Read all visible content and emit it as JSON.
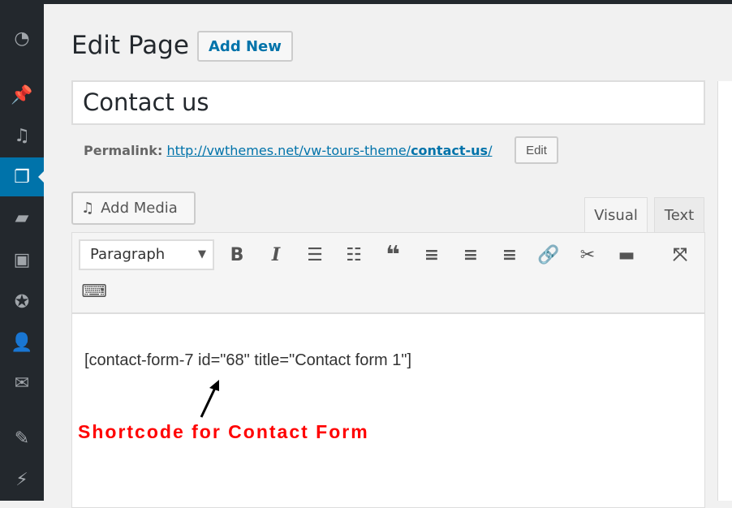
{
  "sidebar": {
    "items": [
      {
        "icon": "dashboard-icon",
        "glyph": "◔"
      },
      {
        "icon": "pin-icon",
        "glyph": "📌"
      },
      {
        "icon": "media-icon",
        "glyph": "♫"
      },
      {
        "icon": "pages-icon",
        "glyph": "❐",
        "active": true
      },
      {
        "icon": "comments-icon",
        "glyph": "▰"
      },
      {
        "icon": "gallery-icon",
        "glyph": "▣"
      },
      {
        "icon": "award-icon",
        "glyph": "✪"
      },
      {
        "icon": "user-icon",
        "glyph": "👤"
      },
      {
        "icon": "mail-icon",
        "glyph": "✉"
      },
      {
        "icon": "appearance-icon",
        "glyph": "✎"
      },
      {
        "icon": "plugins-icon",
        "glyph": "⚡"
      }
    ]
  },
  "header": {
    "title": "Edit Page",
    "add_new": "Add New"
  },
  "post": {
    "title": "Contact us"
  },
  "permalink": {
    "label": "Permalink:",
    "url_base": "http://vwthemes.net/vw-tours-theme/",
    "slug": "contact-us",
    "url_end": "/",
    "edit": "Edit"
  },
  "editor": {
    "add_media": "Add Media",
    "tab_visual": "Visual",
    "tab_text": "Text",
    "format": "Paragraph",
    "content": "[contact-form-7 id=\"68\" title=\"Contact form 1\"]"
  },
  "annotation": {
    "text": "Shortcode for Contact Form",
    "color": "#ff0000"
  },
  "colors": {
    "sidebar": "#23282d",
    "accent": "#0073aa"
  }
}
